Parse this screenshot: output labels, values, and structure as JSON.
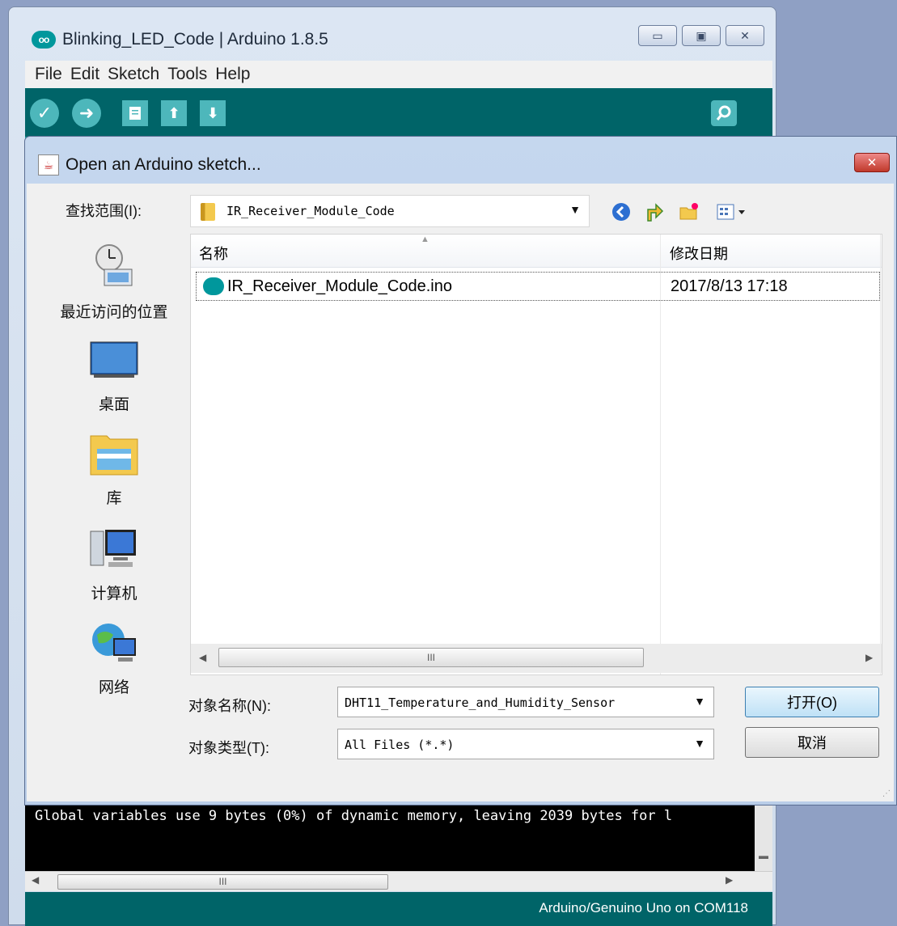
{
  "main_window": {
    "title": "Blinking_LED_Code | Arduino 1.8.5",
    "logo": "arduino-logo",
    "controls": [
      "minimize",
      "maximize",
      "close"
    ],
    "menu": [
      "File",
      "Edit",
      "Sketch",
      "Tools",
      "Help"
    ],
    "toolbar": [
      "verify",
      "upload",
      "new",
      "open",
      "save",
      "serial-monitor"
    ],
    "console_text": "Global variables use 9 bytes (0%) of dynamic memory, leaving 2039 bytes for l",
    "scroll_thumb_grip": "III",
    "status": "Arduino/Genuino Uno on COM118"
  },
  "dialog": {
    "title": "Open an Arduino sketch...",
    "close_symbol": "✕",
    "look_in_label": "查找范围(I):",
    "look_in_value": "IR_Receiver_Module_Code",
    "places": [
      {
        "label": "最近访问的位置",
        "icon": "recent-places-icon"
      },
      {
        "label": "桌面",
        "icon": "desktop-icon"
      },
      {
        "label": "库",
        "icon": "libraries-icon"
      },
      {
        "label": "计算机",
        "icon": "computer-icon"
      },
      {
        "label": "网络",
        "icon": "network-icon"
      }
    ],
    "columns": {
      "name": "名称",
      "date": "修改日期",
      "extra": " "
    },
    "files": [
      {
        "name": "IR_Receiver_Module_Code.ino",
        "date": "2017/8/13 17:18"
      }
    ],
    "scroll_thumb_grip": "III",
    "file_name_label": "对象名称(N):",
    "file_name_value": "DHT11_Temperature_and_Humidity_Sensor",
    "file_type_label": "对象类型(T):",
    "file_type_value": "All Files (*.*)",
    "open_button": "打开(O)",
    "cancel_button": "取消"
  },
  "colors": {
    "arduino_teal": "#006468",
    "arduino_accent": "#4db7bb",
    "dialog_frame": "#c5d7ee"
  }
}
